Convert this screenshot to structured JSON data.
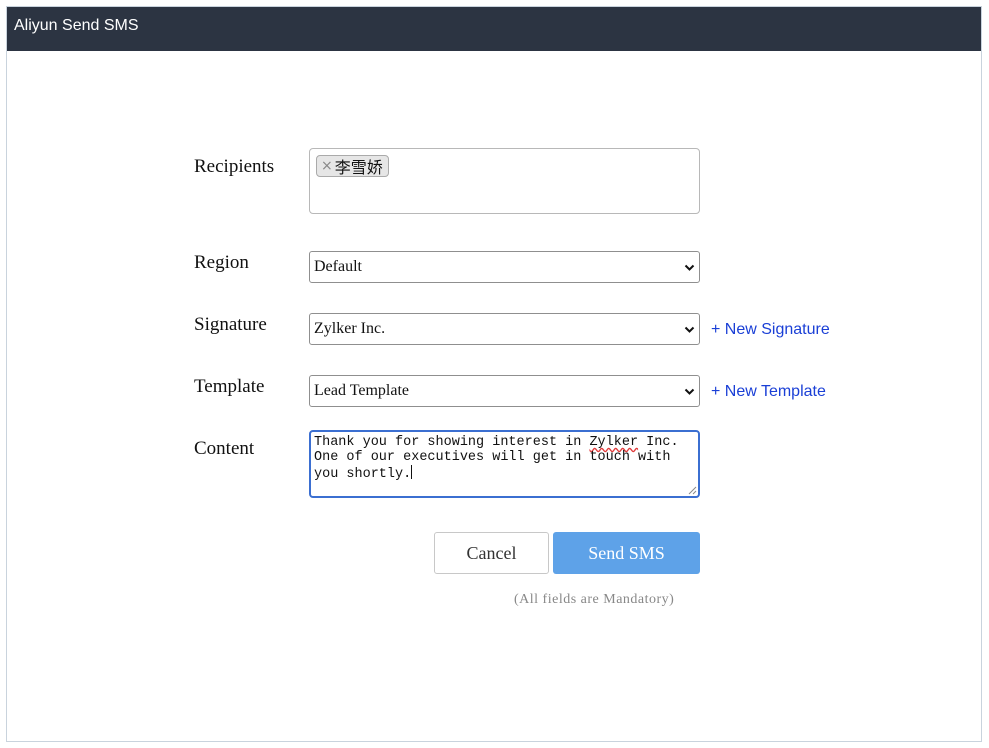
{
  "window": {
    "title": "Aliyun Send SMS"
  },
  "form": {
    "recipients_label": "Recipients",
    "recipients": [
      {
        "name": "李雪娇"
      }
    ],
    "region_label": "Region",
    "region_value": "Default",
    "signature_label": "Signature",
    "signature_value": "Zylker Inc.",
    "new_signature_link": "+ New Signature",
    "template_label": "Template",
    "template_value": "Lead Template",
    "new_template_link": "+ New Template",
    "content_label": "Content",
    "content_line1_before": "Thank you for showing interest in ",
    "content_line1_misspelled": "Zylker",
    "content_line1_after": " Inc.",
    "content_line2": "One of our executives will get in touch with",
    "content_line3": "you shortly."
  },
  "actions": {
    "cancel_label": "Cancel",
    "send_label": "Send SMS",
    "note": "(All fields are Mandatory)"
  },
  "colors": {
    "titlebar": "#2c3442",
    "link": "#1a3fd6",
    "primary_button": "#5ea2e8",
    "focus_border": "#3b6fd1"
  },
  "icons": {
    "chip_remove": "close-icon",
    "select_arrow": "chevron-down-icon",
    "textarea_resize": "resize-handle-icon"
  }
}
